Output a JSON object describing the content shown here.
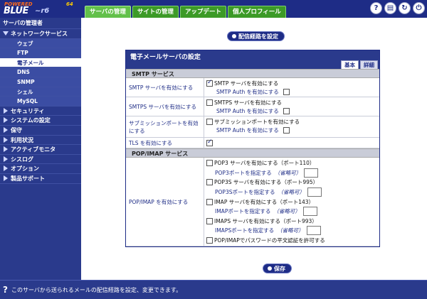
{
  "logo": {
    "powered": "POWERED",
    "blue": "BLUE",
    "quartz": "~r6",
    "bits": "64"
  },
  "tabs": [
    {
      "label": "サーバの管理",
      "active": true
    },
    {
      "label": "サイトの管理",
      "active": false
    },
    {
      "label": "アップデート",
      "active": false
    },
    {
      "label": "個人プロフィール",
      "active": false
    }
  ],
  "top_icons": [
    "help-icon",
    "console-icon",
    "refresh-icon",
    "logout-icon"
  ],
  "sidebar": {
    "header": "サーバの管理者",
    "network_services": "ネットワークサービス",
    "sub": {
      "web": "ウェブ",
      "ftp": "FTP",
      "email": "電子メール",
      "dns": "DNS",
      "snmp": "SNMP",
      "shell": "シェル",
      "mysql": "MySQL"
    },
    "categories": [
      "セキュリティ",
      "システムの設定",
      "保守",
      "利用状況",
      "アクティブモニタ",
      "シスログ",
      "オプション",
      "製品サポート"
    ]
  },
  "route_button": "配信経路を設定",
  "panel": {
    "title": "電子メールサーバの設定",
    "tab_basic": "基本",
    "tab_detail": "詳細",
    "smtp_section": "SMTP サービス",
    "pop_section": "POP/IMAP サービス",
    "smtp": {
      "label": "SMTP サーバを有効にする",
      "enable": "SMTP サーバを有効にする",
      "auth": "SMTP Auth を有効にする"
    },
    "smtps": {
      "label": "SMTPS サーバを有効にする",
      "enable": "SMTPS サーバを有効にする",
      "auth": "SMTP Auth を有効にする"
    },
    "submission": {
      "label": "サブミッションポートを有効にする",
      "enable": "サブミッションポートを有効にする",
      "auth": "SMTP Auth を有効にする"
    },
    "tls": {
      "label": "TLS を有効にする"
    },
    "pop": {
      "label": "POP/IMAP を有効にする",
      "pop3": "POP3 サーバを有効にする（ポート110）",
      "pop3_port": "POP3ポートを指定する",
      "pop3s": "POP3S サーバを有効にする（ポート995）",
      "pop3s_port": "POP3Sポートを指定する",
      "imap": "IMAP サーバを有効にする（ポート143）",
      "imap_port": "IMAPポートを指定する",
      "imaps": "IMAPS サーバを有効にする（ポート993）",
      "imaps_port": "IMAPSポートを指定する",
      "optional": "（省略可）",
      "plain_auth": "POP/IMAPでパスワードの平文認証を許可する"
    }
  },
  "save_button": "保存",
  "status": "このサーバから送られるメールの配信経路を設定、変更できます。"
}
